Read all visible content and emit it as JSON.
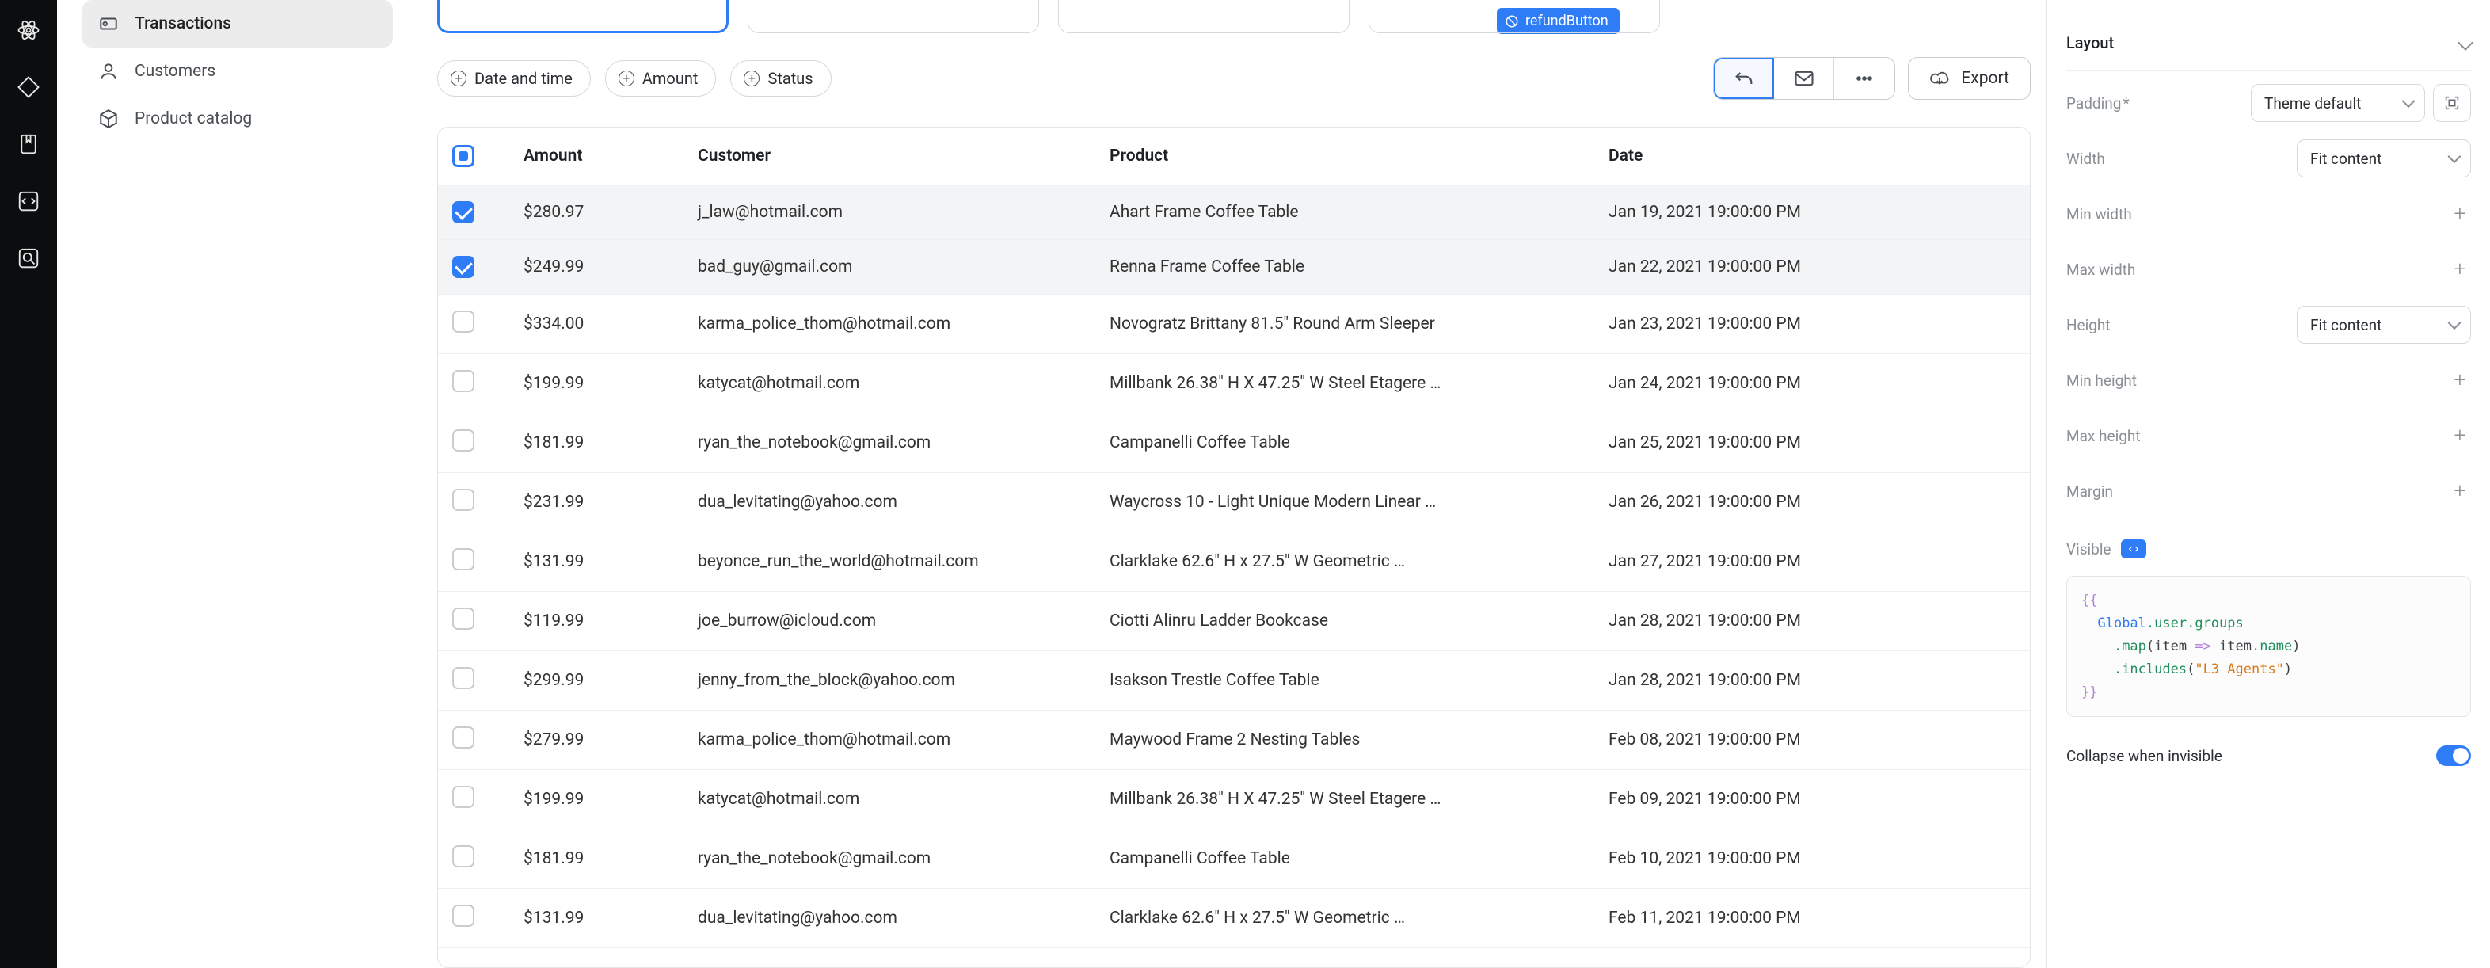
{
  "sidebar": {
    "items": [
      {
        "label": "Transactions",
        "active": true
      },
      {
        "label": "Customers",
        "active": false
      },
      {
        "label": "Product catalog",
        "active": false
      }
    ]
  },
  "floating_tag": "refundButton",
  "filters": {
    "chips": [
      "Date and time",
      "Amount",
      "Status"
    ],
    "export_label": "Export"
  },
  "table": {
    "headers": {
      "amount": "Amount",
      "customer": "Customer",
      "product": "Product",
      "date": "Date"
    },
    "rows": [
      {
        "checked": true,
        "amount": "$280.97",
        "customer": "j_law@hotmail.com",
        "product": "Ahart Frame Coffee Table",
        "date": "Jan 19, 2021 19:00:00 PM"
      },
      {
        "checked": true,
        "amount": "$249.99",
        "customer": "bad_guy@gmail.com",
        "product": "Renna Frame Coffee Table",
        "date": "Jan 22, 2021 19:00:00 PM"
      },
      {
        "checked": false,
        "amount": "$334.00",
        "customer": "karma_police_thom@hotmail.com",
        "product": "Novogratz Brittany 81.5\" Round Arm Sleeper",
        "date": "Jan 23, 2021 19:00:00 PM"
      },
      {
        "checked": false,
        "amount": "$199.99",
        "customer": "katycat@hotmail.com",
        "product": "Millbank 26.38\" H X 47.25\" W Steel Etagere …",
        "date": "Jan 24, 2021 19:00:00 PM"
      },
      {
        "checked": false,
        "amount": "$181.99",
        "customer": "ryan_the_notebook@gmail.com",
        "product": "Campanelli Coffee Table",
        "date": "Jan 25, 2021 19:00:00 PM"
      },
      {
        "checked": false,
        "amount": "$231.99",
        "customer": "dua_levitating@yahoo.com",
        "product": "Waycross 10 - Light Unique Modern Linear …",
        "date": "Jan 26, 2021 19:00:00 PM"
      },
      {
        "checked": false,
        "amount": "$131.99",
        "customer": "beyonce_run_the_world@hotmail.com",
        "product": "Clarklake 62.6\" H x 27.5\" W Geometric …",
        "date": "Jan 27, 2021 19:00:00 PM"
      },
      {
        "checked": false,
        "amount": "$119.99",
        "customer": "joe_burrow@icloud.com",
        "product": "Ciotti Alinru Ladder Bookcase",
        "date": "Jan 28, 2021 19:00:00 PM"
      },
      {
        "checked": false,
        "amount": "$299.99",
        "customer": "jenny_from_the_block@yahoo.com",
        "product": "Isakson Trestle Coffee Table",
        "date": "Jan 28, 2021 19:00:00 PM"
      },
      {
        "checked": false,
        "amount": "$279.99",
        "customer": "karma_police_thom@hotmail.com",
        "product": "Maywood Frame 2 Nesting Tables",
        "date": "Feb 08, 2021 19:00:00 PM"
      },
      {
        "checked": false,
        "amount": "$199.99",
        "customer": "katycat@hotmail.com",
        "product": "Millbank 26.38\" H X 47.25\" W Steel Etagere …",
        "date": "Feb 09, 2021 19:00:00 PM"
      },
      {
        "checked": false,
        "amount": "$181.99",
        "customer": "ryan_the_notebook@gmail.com",
        "product": "Campanelli Coffee Table",
        "date": "Feb 10, 2021 19:00:00 PM"
      },
      {
        "checked": false,
        "amount": "$131.99",
        "customer": "dua_levitating@yahoo.com",
        "product": "Clarklake 62.6\" H x 27.5\" W Geometric …",
        "date": "Feb 11, 2021 19:00:00 PM"
      }
    ]
  },
  "panel": {
    "section": "Layout",
    "padding_label": "Padding",
    "padding_req": "*",
    "padding_value": "Theme default",
    "width_label": "Width",
    "width_value": "Fit content",
    "min_width_label": "Min width",
    "max_width_label": "Max width",
    "height_label": "Height",
    "height_value": "Fit content",
    "min_height_label": "Min height",
    "max_height_label": "Max height",
    "margin_label": "Margin",
    "visible_label": "Visible",
    "code_tokens": {
      "open": "{{",
      "l1a": "Global",
      "l1b": ".user",
      "l1c": ".groups",
      "l2a": ".map",
      "l2b": "(item ",
      "l2c": "=>",
      "l2d": " item",
      "l2e": ".name",
      "l2f": ")",
      "l3a": ".includes",
      "l3b": "(",
      "l3c": "\"L3 Agents\"",
      "l3d": ")",
      "close": "}}"
    },
    "collapse_label": "Collapse when invisible",
    "collapse_value": true
  }
}
